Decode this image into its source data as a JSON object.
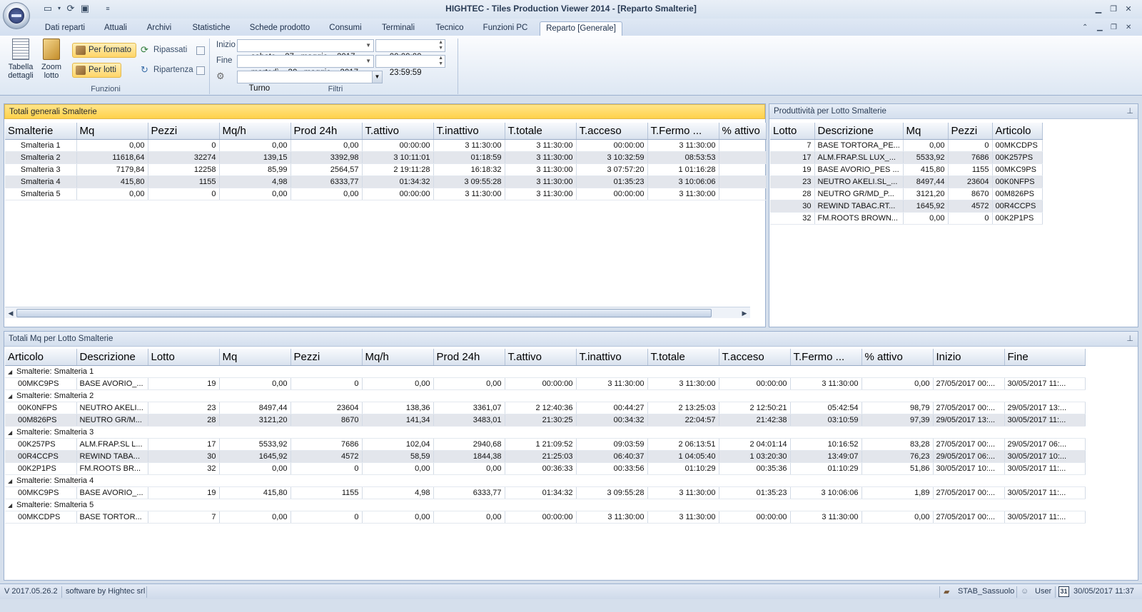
{
  "window": {
    "title": "HIGHTEC - Tiles Production Viewer 2014 - [Reparto Smalterie]"
  },
  "tabs": [
    {
      "label": "Dati reparti"
    },
    {
      "label": "Attuali"
    },
    {
      "label": "Archivi"
    },
    {
      "label": "Statistiche"
    },
    {
      "label": "Schede prodotto"
    },
    {
      "label": "Consumi"
    },
    {
      "label": "Terminali"
    },
    {
      "label": "Tecnico"
    },
    {
      "label": "Funzioni PC"
    },
    {
      "label": "Reparto [Generale]",
      "active": true
    }
  ],
  "ribbon": {
    "funzioni": {
      "label": "Funzioni",
      "tabella": "Tabella\ndettagli",
      "zoom": "Zoom\nlotto",
      "per_formato": "Per formato",
      "per_lotti": "Per lotti",
      "ripassati": "Ripassati",
      "ripartenza": "Ripartenza"
    },
    "filtri": {
      "label": "Filtri",
      "inizio_label": "Inizio",
      "inizio_date": "sabato    27   maggio    2017",
      "inizio_time": "00:00:00",
      "fine_label": "Fine",
      "fine_date": "martedì    30   maggio    2017",
      "fine_time": "23:59:59",
      "turno": "Turno"
    }
  },
  "totali": {
    "title": "Totali generali Smalterie",
    "columns": [
      "Smalterie",
      "Mq",
      "Pezzi",
      "Mq/h",
      "Prod 24h",
      "T.attivo",
      "T.inattivo",
      "T.totale",
      "T.acceso",
      "T.Fermo ...",
      "% attivo"
    ],
    "rows": [
      [
        "Smalteria 1",
        "0,00",
        "0",
        "0,00",
        "0,00",
        "00:00:00",
        "3 11:30:00",
        "3 11:30:00",
        "00:00:00",
        "3 11:30:00",
        ""
      ],
      [
        "Smalteria 2",
        "11618,64",
        "32274",
        "139,15",
        "3392,98",
        "3 10:11:01",
        "01:18:59",
        "3 11:30:00",
        "3 10:32:59",
        "08:53:53",
        ""
      ],
      [
        "Smalteria 3",
        "7179,84",
        "12258",
        "85,99",
        "2564,57",
        "2 19:11:28",
        "16:18:32",
        "3 11:30:00",
        "3 07:57:20",
        "1 01:16:28",
        ""
      ],
      [
        "Smalteria 4",
        "415,80",
        "1155",
        "4,98",
        "6333,77",
        "01:34:32",
        "3 09:55:28",
        "3 11:30:00",
        "01:35:23",
        "3 10:06:06",
        ""
      ],
      [
        "Smalteria 5",
        "0,00",
        "0",
        "0,00",
        "0,00",
        "00:00:00",
        "3 11:30:00",
        "3 11:30:00",
        "00:00:00",
        "3 11:30:00",
        ""
      ]
    ]
  },
  "produttivita": {
    "title": "Produttività per Lotto Smalterie",
    "columns": [
      "Lotto",
      "Descrizione",
      "Mq",
      "Pezzi",
      "Articolo"
    ],
    "rows": [
      [
        "7",
        "BASE TORTORA_PE...",
        "0,00",
        "0",
        "00MKCDPS"
      ],
      [
        "17",
        "ALM.FRAP.SL LUX_...",
        "5533,92",
        "7686",
        "00K257PS"
      ],
      [
        "19",
        "BASE AVORIO_PES ...",
        "415,80",
        "1155",
        "00MKC9PS"
      ],
      [
        "23",
        "NEUTRO AKELI.SL_...",
        "8497,44",
        "23604",
        "00K0NFPS"
      ],
      [
        "28",
        "NEUTRO GR/MD_P...",
        "3121,20",
        "8670",
        "00M826PS"
      ],
      [
        "30",
        "REWIND TABAC.RT...",
        "1645,92",
        "4572",
        "00R4CCPS"
      ],
      [
        "32",
        "FM.ROOTS BROWN...",
        "0,00",
        "0",
        "00K2P1PS"
      ]
    ]
  },
  "lotti": {
    "title": "Totali Mq per Lotto Smalterie",
    "columns": [
      "Articolo",
      "Descrizione",
      "Lotto",
      "Mq",
      "Pezzi",
      "Mq/h",
      "Prod 24h",
      "T.attivo",
      "T.inattivo",
      "T.totale",
      "T.acceso",
      "T.Fermo ...",
      "% attivo",
      "Inizio",
      "Fine"
    ],
    "groups": [
      {
        "label": "Smalterie:  Smalteria 1",
        "rows": [
          [
            "00MKC9PS",
            "BASE AVORIO_...",
            "19",
            "0,00",
            "0",
            "0,00",
            "0,00",
            "00:00:00",
            "3 11:30:00",
            "3 11:30:00",
            "00:00:00",
            "3 11:30:00",
            "0,00",
            "27/05/2017 00:...",
            "30/05/2017 11:..."
          ]
        ]
      },
      {
        "label": "Smalterie:  Smalteria 2",
        "rows": [
          [
            "00K0NFPS",
            "NEUTRO AKELI...",
            "23",
            "8497,44",
            "23604",
            "138,36",
            "3361,07",
            "2 12:40:36",
            "00:44:27",
            "2 13:25:03",
            "2 12:50:21",
            "05:42:54",
            "98,79",
            "27/05/2017 00:...",
            "29/05/2017 13:..."
          ],
          [
            "00M826PS",
            "NEUTRO GR/M...",
            "28",
            "3121,20",
            "8670",
            "141,34",
            "3483,01",
            "21:30:25",
            "00:34:32",
            "22:04:57",
            "21:42:38",
            "03:10:59",
            "97,39",
            "29/05/2017 13:...",
            "30/05/2017 11:..."
          ]
        ]
      },
      {
        "label": "Smalterie:  Smalteria 3",
        "rows": [
          [
            "00K257PS",
            "ALM.FRAP.SL L...",
            "17",
            "5533,92",
            "7686",
            "102,04",
            "2940,68",
            "1 21:09:52",
            "09:03:59",
            "2 06:13:51",
            "2 04:01:14",
            "10:16:52",
            "83,28",
            "27/05/2017 00:...",
            "29/05/2017 06:..."
          ],
          [
            "00R4CCPS",
            "REWIND TABA...",
            "30",
            "1645,92",
            "4572",
            "58,59",
            "1844,38",
            "21:25:03",
            "06:40:37",
            "1 04:05:40",
            "1 03:20:30",
            "13:49:07",
            "76,23",
            "29/05/2017 06:...",
            "30/05/2017 10:..."
          ],
          [
            "00K2P1PS",
            "FM.ROOTS BR...",
            "32",
            "0,00",
            "0",
            "0,00",
            "0,00",
            "00:36:33",
            "00:33:56",
            "01:10:29",
            "00:35:36",
            "01:10:29",
            "51,86",
            "30/05/2017 10:...",
            "30/05/2017 11:..."
          ]
        ]
      },
      {
        "label": "Smalterie:  Smalteria 4",
        "rows": [
          [
            "00MKC9PS",
            "BASE AVORIO_...",
            "19",
            "415,80",
            "1155",
            "4,98",
            "6333,77",
            "01:34:32",
            "3 09:55:28",
            "3 11:30:00",
            "01:35:23",
            "3 10:06:06",
            "1,89",
            "27/05/2017 00:...",
            "30/05/2017 11:..."
          ]
        ]
      },
      {
        "label": "Smalterie:  Smalteria 5",
        "rows": [
          [
            "00MKCDPS",
            "BASE TORTOR...",
            "7",
            "0,00",
            "0",
            "0,00",
            "0,00",
            "00:00:00",
            "3 11:30:00",
            "3 11:30:00",
            "00:00:00",
            "3 11:30:00",
            "0,00",
            "27/05/2017 00:...",
            "30/05/2017 11:..."
          ]
        ]
      }
    ]
  },
  "status": {
    "version": "V 2017.05.26.2",
    "software": "software by Hightec srl",
    "site": "STAB_Sassuolo",
    "user": "User",
    "datetime": "30/05/2017 11:37",
    "calendar_day": "31"
  },
  "colors": {
    "accent_yellow": "#ffd14a",
    "ribbon_blue": "#d5dfec",
    "alt_row": "#e3e6ec"
  }
}
